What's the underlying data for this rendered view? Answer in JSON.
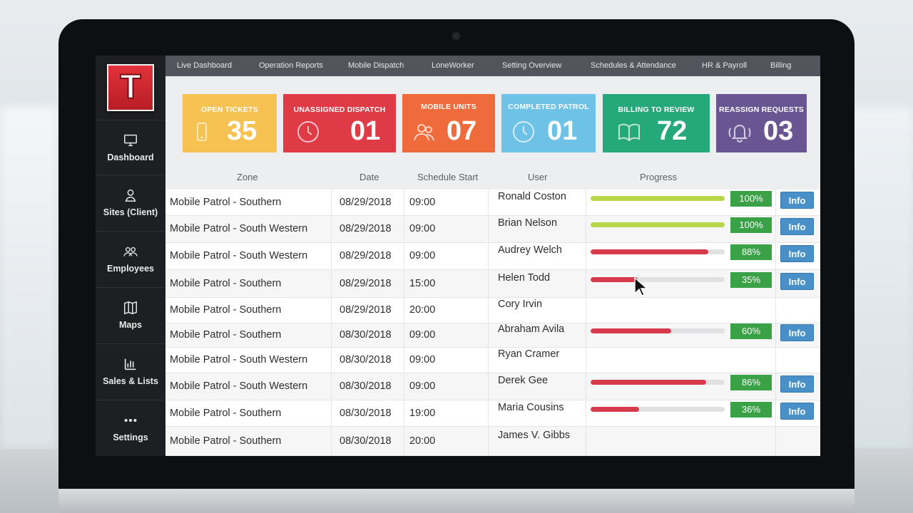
{
  "app": {
    "logo_letter": "T"
  },
  "sidebar": {
    "items": [
      {
        "label": "Dashboard",
        "icon": "monitor-icon"
      },
      {
        "label": "Sites (Client)",
        "icon": "building-icon"
      },
      {
        "label": "Employees",
        "icon": "people-icon"
      },
      {
        "label": "Maps",
        "icon": "map-icon"
      },
      {
        "label": "Sales & Lists",
        "icon": "bar-chart-icon"
      },
      {
        "label": "Settings",
        "icon": "more-dots-icon"
      }
    ]
  },
  "topnav": {
    "items": [
      "Live Dashboard",
      "Operation Reports",
      "Mobile Dispatch",
      "LoneWorker",
      "Setting Overview",
      "Schedules & Attendance",
      "HR & Payroll",
      "Billing"
    ]
  },
  "tiles": [
    {
      "title": "OPEN TICKETS",
      "value": "35",
      "color": "#f6c251",
      "icon": "phone-icon"
    },
    {
      "title": "UNASSIGNED DISPATCH",
      "value": "01",
      "color": "#de3b47",
      "icon": "clock-icon"
    },
    {
      "title": "MOBILE UNITS",
      "value": "07",
      "color": "#f06b3c",
      "icon": "people-icon"
    },
    {
      "title": "COMPLETED PATROL",
      "value": "01",
      "color": "#6ec2e6",
      "icon": "clock-icon"
    },
    {
      "title": "BILLING TO REVIEW",
      "value": "72",
      "color": "#25a87a",
      "icon": "book-icon"
    },
    {
      "title": "REASSIGN REQUESTS",
      "value": "03",
      "color": "#6a5593",
      "icon": "bell-icon"
    }
  ],
  "table": {
    "headers": {
      "zone": "Zone",
      "date": "Date",
      "schedule_start": "Schedule Start",
      "user": "User",
      "progress": "Progress"
    },
    "info_label": "Info",
    "rows": [
      {
        "zone": "Mobile Patrol - Southern",
        "date": "08/29/2018",
        "start": "09:00",
        "user": "Ronald Coston",
        "progress": 100,
        "progress_label": "100%",
        "bar_color": "#b8d64a"
      },
      {
        "zone": "Mobile Patrol - South Western",
        "date": "08/29/2018",
        "start": "09:00",
        "user": "Brian Nelson",
        "progress": 100,
        "progress_label": "100%",
        "bar_color": "#b8d64a"
      },
      {
        "zone": "Mobile Patrol - South Western",
        "date": "08/29/2018",
        "start": "09:00",
        "user": "Audrey Welch",
        "progress": 88,
        "progress_label": "88%",
        "bar_color": "#d63b4b"
      },
      {
        "zone": "Mobile Patrol - Southern",
        "date": "08/29/2018",
        "start": "15:00",
        "user": "Helen Todd",
        "progress": 35,
        "progress_label": "35%",
        "bar_color": "#d63b4b"
      },
      {
        "zone": "Mobile Patrol - Southern",
        "date": "08/29/2018",
        "start": "20:00",
        "user": "Cory Irvin",
        "progress": null,
        "progress_label": null,
        "bar_color": null
      },
      {
        "zone": "Mobile Patrol - Southern",
        "date": "08/30/2018",
        "start": "09:00",
        "user": "Abraham Avila",
        "progress": 60,
        "progress_label": "60%",
        "bar_color": "#d63b4b"
      },
      {
        "zone": "Mobile Patrol - South Western",
        "date": "08/30/2018",
        "start": "09:00",
        "user": "Ryan Cramer",
        "progress": null,
        "progress_label": null,
        "bar_color": null
      },
      {
        "zone": "Mobile Patrol - South Western",
        "date": "08/30/2018",
        "start": "09:00",
        "user": "Derek Gee",
        "progress": 86,
        "progress_label": "86%",
        "bar_color": "#d63b4b"
      },
      {
        "zone": "Mobile Patrol - Southern",
        "date": "08/30/2018",
        "start": "19:00",
        "user": "Maria Cousins",
        "progress": 36,
        "progress_label": "36%",
        "bar_color": "#d63b4b"
      },
      {
        "zone": "Mobile Patrol - Southern",
        "date": "08/30/2018",
        "start": "20:00",
        "user": "James V. Gibbs",
        "progress": null,
        "progress_label": null,
        "bar_color": null
      }
    ]
  }
}
